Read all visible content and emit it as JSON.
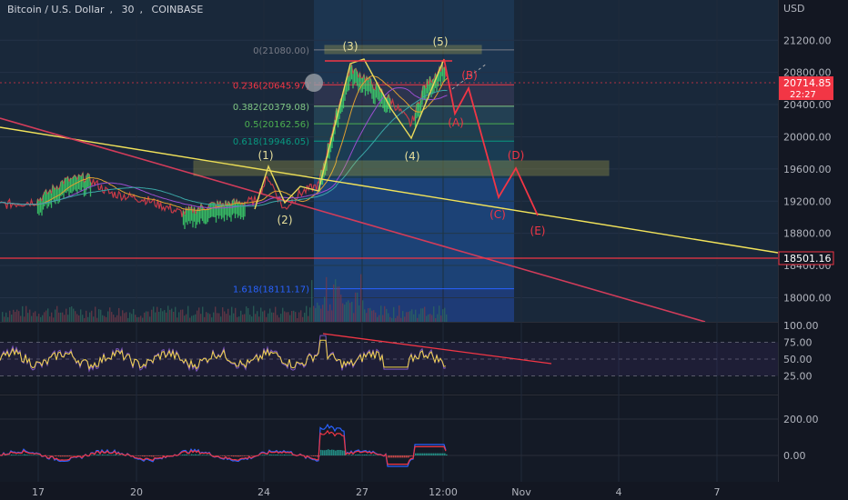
{
  "header": {
    "symbol": "Bitcoin / U.S. Dollar",
    "interval": "30",
    "exchange": "COINBASE",
    "currency": "USD"
  },
  "chart_data": [
    {
      "type": "line",
      "name": "price-pane",
      "y_axis": {
        "ticks": [
          "21200.00",
          "20800.00",
          "20400.00",
          "20000.00",
          "19600.00",
          "19200.00",
          "18800.00",
          "18400.00",
          "18000.00"
        ],
        "ylim": [
          17700,
          21700
        ]
      },
      "x_axis": {
        "ticks": [
          "17",
          "20",
          "24",
          "27",
          "12:00",
          "Nov",
          "4",
          "7"
        ]
      },
      "price_label": {
        "value": "20714.85",
        "countdown": "22:27",
        "color": "#f23645"
      },
      "level_label": {
        "value": "18501.16",
        "color": "#f23645"
      },
      "fib_levels": [
        {
          "label": "0(21080.00)",
          "value": 21080.0
        },
        {
          "label": "0.236(20645.97)",
          "value": 20645.97
        },
        {
          "label": "0.382(20379.08)",
          "value": 20379.08
        },
        {
          "label": "0.5(20162.56)",
          "value": 20162.56
        },
        {
          "label": "0.618(19946.05)",
          "value": 19946.05
        },
        {
          "label": "1.618(18111.17)",
          "value": 18111.17
        }
      ],
      "wave_labels": [
        {
          "text": "(1)",
          "color": "#e8e09c"
        },
        {
          "text": "(2)",
          "color": "#e8e09c"
        },
        {
          "text": "(3)",
          "color": "#e8e09c"
        },
        {
          "text": "(4)",
          "color": "#e8e09c"
        },
        {
          "text": "(5)",
          "color": "#e8e09c"
        },
        {
          "text": "(A)",
          "color": "#f23645"
        },
        {
          "text": "(B)",
          "color": "#f23645"
        },
        {
          "text": "(C)",
          "color": "#f23645"
        },
        {
          "text": "(D)",
          "color": "#f23645"
        },
        {
          "text": "(E)",
          "color": "#f23645"
        }
      ],
      "colors": {
        "fib_box": "#1e3a8a",
        "trend_yellow": "#f2e35a",
        "trend_red": "#d23c5a",
        "rsi_line": "#f2d44a",
        "macd": "#2962ff",
        "signal": "#f23645"
      }
    },
    {
      "type": "line",
      "name": "rsi-pane",
      "y_axis": {
        "ticks": [
          "100.00",
          "75.00",
          "50.00",
          "25.00"
        ],
        "ylim": [
          0,
          100
        ]
      }
    },
    {
      "type": "line",
      "name": "macd-pane",
      "y_axis": {
        "ticks": [
          "200.00",
          "0.00"
        ]
      }
    }
  ]
}
